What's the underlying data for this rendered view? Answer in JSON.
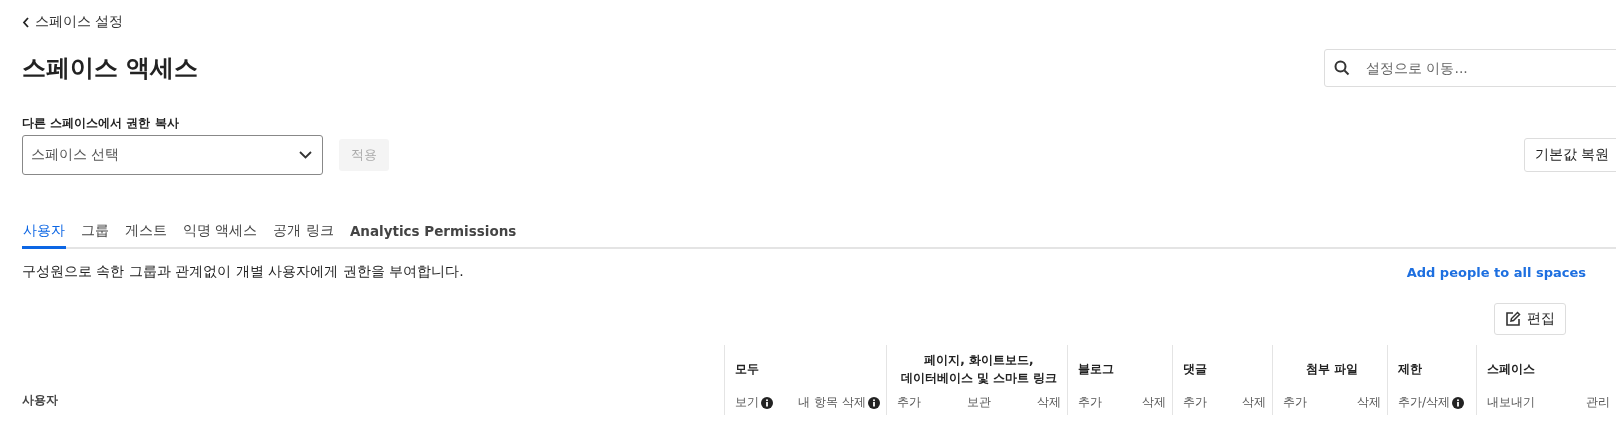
{
  "back_link": "스페이스 설정",
  "title": "스페이스 액세스",
  "search": {
    "placeholder": "설정으로 이동..."
  },
  "copy_permissions": {
    "label": "다른 스페이스에서 권한 복사",
    "select_placeholder": "스페이스 선택",
    "apply_button": {
      "label": "적용",
      "disabled": true
    }
  },
  "restore_button": "기본값 복원",
  "tabs": [
    {
      "label": "사용자",
      "selected": true
    },
    {
      "label": "그룹",
      "selected": false
    },
    {
      "label": "게스트",
      "selected": false
    },
    {
      "label": "익명 액세스",
      "selected": false
    },
    {
      "label": "공개 링크",
      "selected": false
    },
    {
      "label": "Analytics Permissions",
      "selected": false
    }
  ],
  "description": "구성원으로 속한 그룹과 관계없이 개별 사용자에게 권한을 부여합니다.",
  "add_people_link": "Add people to all spaces",
  "edit_button": "편집",
  "table": {
    "first_column": "사용자",
    "column_groups": [
      {
        "title": "모두",
        "centered": false,
        "columns": [
          {
            "label": "보기",
            "info": true
          },
          {
            "label": "내 항목 삭제",
            "info": true
          }
        ]
      },
      {
        "title": "페이지, 화이트보드,\n데이터베이스 및 스마트 링크",
        "centered": true,
        "columns": [
          {
            "label": "추가",
            "info": false
          },
          {
            "label": "보관",
            "info": false
          },
          {
            "label": "삭제",
            "info": false
          }
        ]
      },
      {
        "title": "블로그",
        "centered": false,
        "columns": [
          {
            "label": "추가",
            "info": false
          },
          {
            "label": "삭제",
            "info": false
          }
        ]
      },
      {
        "title": "댓글",
        "centered": false,
        "columns": [
          {
            "label": "추가",
            "info": false
          },
          {
            "label": "삭제",
            "info": false
          }
        ]
      },
      {
        "title": "첨부 파일",
        "centered": true,
        "columns": [
          {
            "label": "추가",
            "info": false
          },
          {
            "label": "삭제",
            "info": false
          }
        ]
      },
      {
        "title": "제한",
        "centered": false,
        "columns": [
          {
            "label": "추가/삭제",
            "info": true
          }
        ]
      },
      {
        "title": "스페이스",
        "centered": false,
        "columns": [
          {
            "label": "내보내기",
            "info": false
          },
          {
            "label": "관리",
            "info": false
          }
        ]
      }
    ]
  }
}
